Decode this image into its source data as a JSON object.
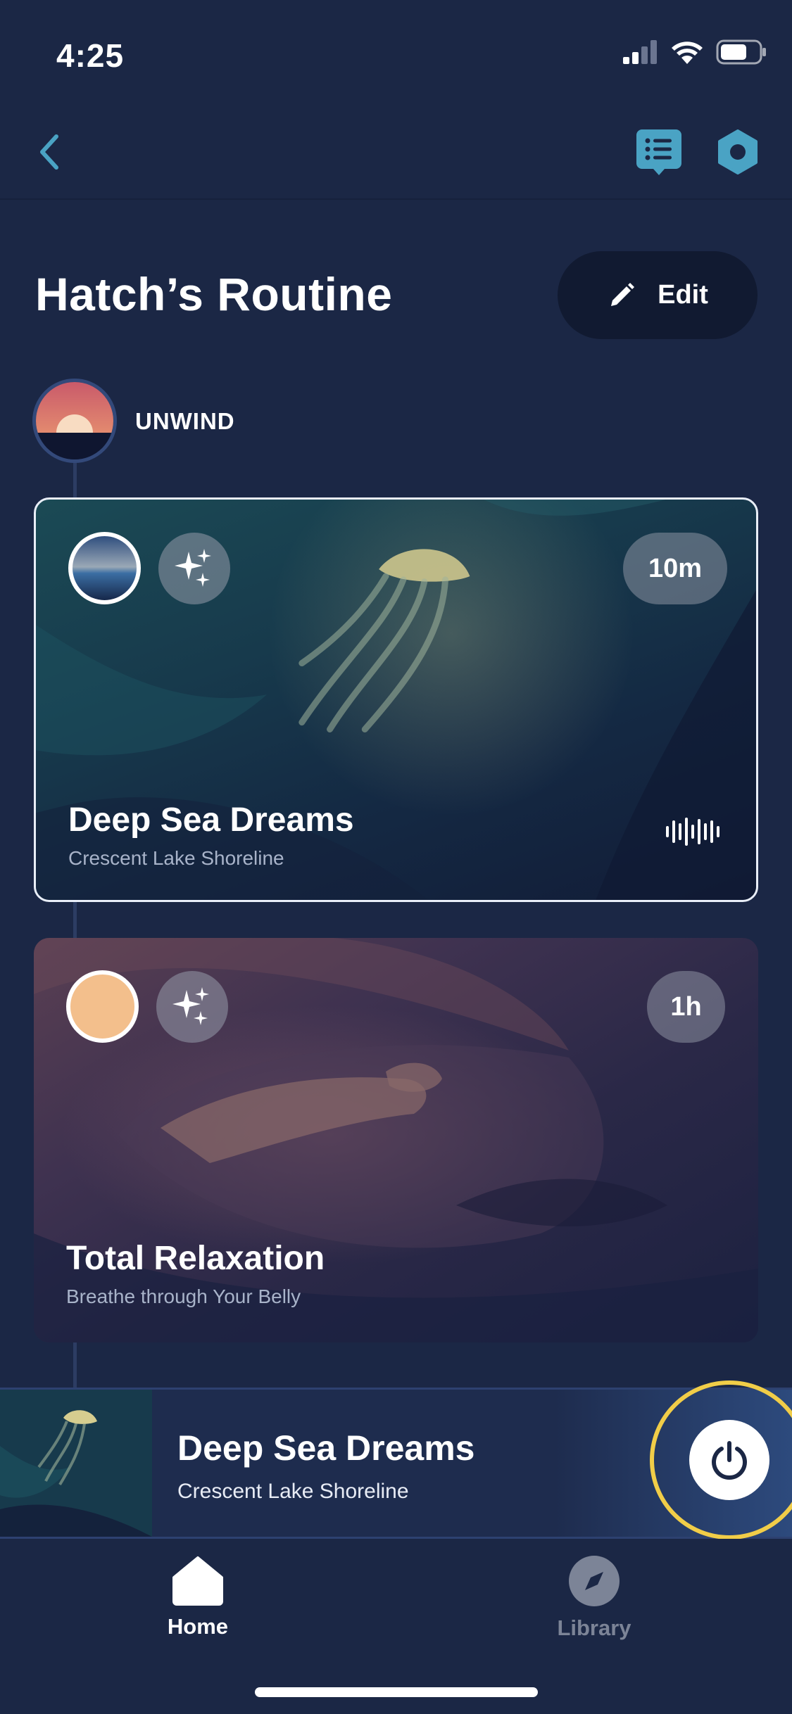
{
  "status_bar": {
    "time": "4:25"
  },
  "header": {
    "title": "Hatch’s Routine",
    "edit_label": "Edit"
  },
  "section": {
    "label": "UNWIND"
  },
  "cards": [
    {
      "title": "Deep Sea Dreams",
      "subtitle": "Crescent Lake Shoreline",
      "duration": "10m",
      "color_circle": "blue-gradient",
      "selected": true,
      "icons": [
        "sparkles-icon",
        "waveform-icon"
      ]
    },
    {
      "title": "Total Relaxation",
      "subtitle": "Breathe through Your Belly",
      "duration": "1h",
      "color_circle": "#f3bf8c",
      "selected": false,
      "icons": [
        "sparkles-icon"
      ]
    }
  ],
  "now_playing": {
    "title": "Deep Sea Dreams",
    "subtitle": "Crescent Lake Shoreline"
  },
  "tabs": [
    {
      "label": "Home",
      "icon": "home-icon",
      "active": true
    },
    {
      "label": "Library",
      "icon": "compass-icon",
      "active": false
    }
  ],
  "colors": {
    "background": "#1b2745",
    "accent": "#4aa3c4",
    "power_ring": "#f1cd48",
    "tab_inactive": "#7c8497"
  }
}
